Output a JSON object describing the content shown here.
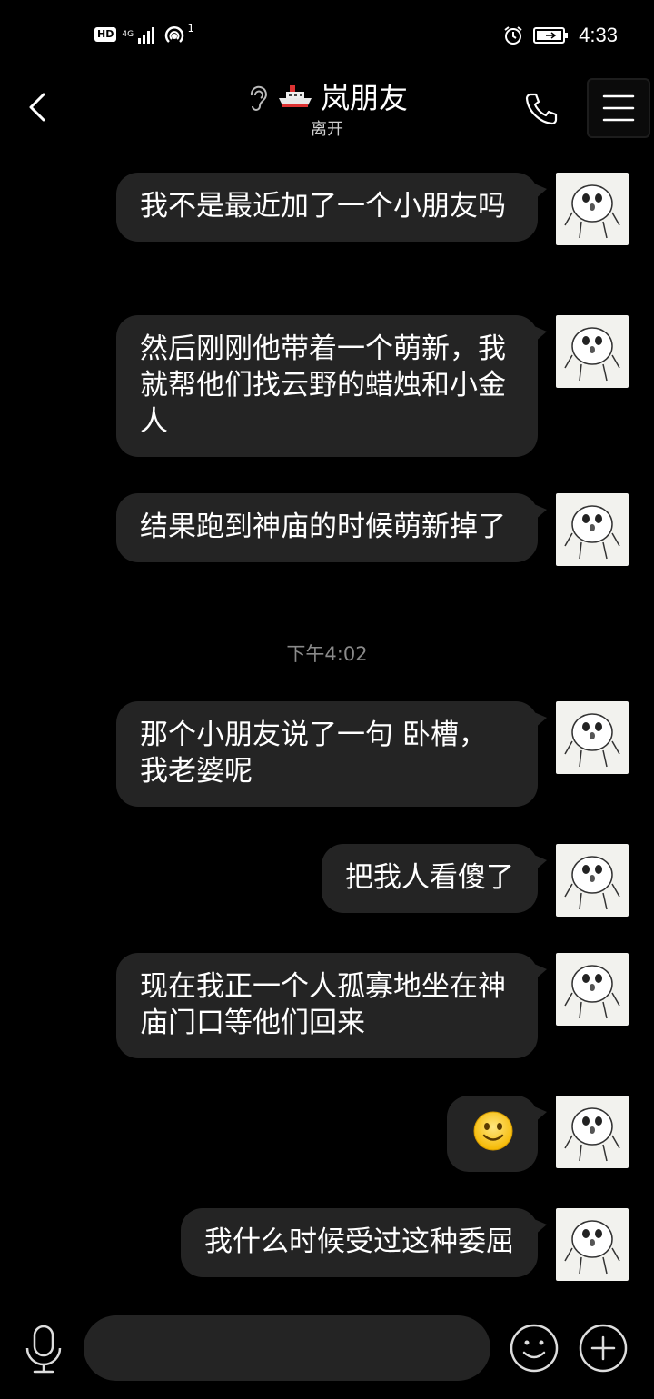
{
  "status_bar": {
    "hd": "HD",
    "network": "4G",
    "hotspot_count": "1",
    "time": "4:33"
  },
  "header": {
    "title_icon": "ship-emoji",
    "title": "岚朋友",
    "status": "离开"
  },
  "messages": [
    {
      "type": "text",
      "text": "我不是最近加了一个小朋友吗"
    },
    {
      "type": "text",
      "text": "然后刚刚他带着一个萌新，我就帮他们找云野的蜡烛和小金人"
    },
    {
      "type": "text",
      "text": "结果跑到神庙的时候萌新掉了"
    },
    {
      "type": "timestamp",
      "text": "下午4:02"
    },
    {
      "type": "text",
      "text": "那个小朋友说了一句 卧槽，我老婆呢"
    },
    {
      "type": "text",
      "text": "把我人看傻了"
    },
    {
      "type": "text",
      "text": "现在我正一个人孤寡地坐在神庙门口等他们回来"
    },
    {
      "type": "emoji",
      "icon": "smile-emoji"
    },
    {
      "type": "text",
      "text": "我什么时候受过这种委屈"
    }
  ],
  "input_bar": {
    "placeholder": ""
  },
  "colors": {
    "background": "#000000",
    "bubble": "#242424",
    "text": "#ffffff",
    "timestamp": "#8a8a8a"
  }
}
